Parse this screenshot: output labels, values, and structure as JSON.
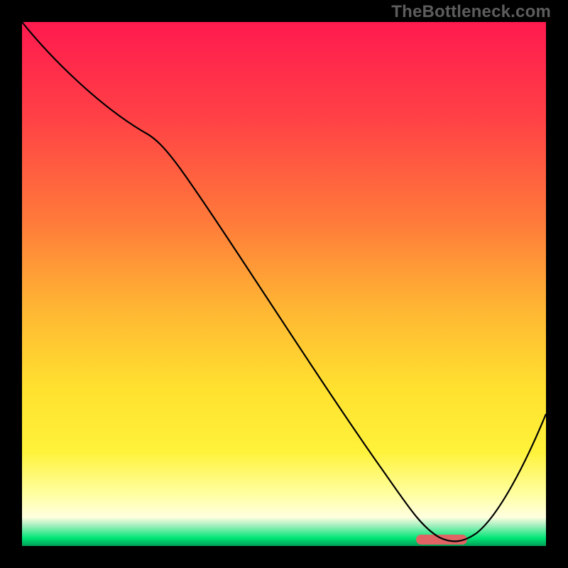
{
  "watermark": "TheBottleneck.com",
  "colors": {
    "frame": "#000000",
    "curve": "#000000",
    "marker": "#e06464",
    "gradient_stops": [
      {
        "offset": 0.0,
        "color": "#ff1a4f"
      },
      {
        "offset": 0.18,
        "color": "#ff4046"
      },
      {
        "offset": 0.38,
        "color": "#ff7a3a"
      },
      {
        "offset": 0.55,
        "color": "#ffb733"
      },
      {
        "offset": 0.7,
        "color": "#ffe12f"
      },
      {
        "offset": 0.82,
        "color": "#fff23a"
      },
      {
        "offset": 0.9,
        "color": "#ffffa0"
      },
      {
        "offset": 0.945,
        "color": "#ffffe0"
      },
      {
        "offset": 0.96,
        "color": "#a8f0c0"
      },
      {
        "offset": 0.985,
        "color": "#00e676"
      },
      {
        "offset": 1.0,
        "color": "#009d55"
      }
    ]
  },
  "chart_data": {
    "type": "line",
    "title": "",
    "xlabel": "",
    "ylabel": "",
    "xlim": [
      0,
      100
    ],
    "ylim": [
      0,
      100
    ],
    "x": [
      0,
      8,
      18,
      24,
      30,
      40,
      50,
      60,
      68,
      74,
      78,
      82,
      86,
      92,
      100
    ],
    "values": [
      100,
      91,
      80,
      73,
      65,
      52,
      38,
      25,
      14,
      6,
      2,
      0,
      2,
      10,
      25
    ],
    "marker_region": {
      "x_start": 75,
      "x_end": 85,
      "y": 0
    }
  }
}
